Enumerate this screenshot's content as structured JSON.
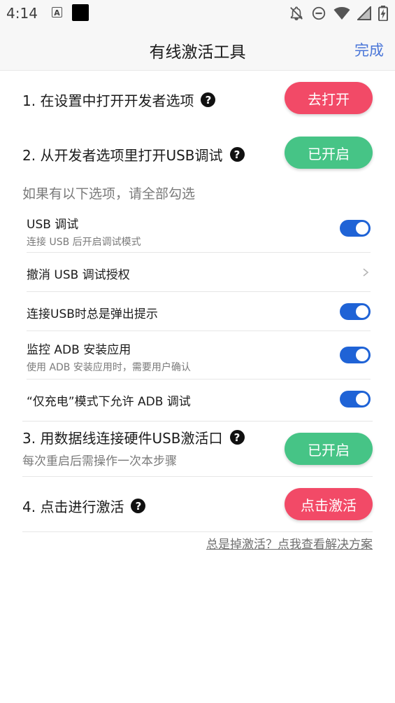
{
  "status_bar": {
    "time": "4:14",
    "icons": [
      "a-badge-icon",
      "black-square-icon",
      "notifications-off-icon",
      "do-not-disturb-icon",
      "wifi-icon",
      "signal-icon",
      "battery-charging-icon"
    ],
    "badge_letter": "A"
  },
  "header": {
    "title": "有线激活工具",
    "done_label": "完成",
    "done_color": "#4a76d8"
  },
  "steps": [
    {
      "label": "1. 在设置中打开开发者选项",
      "button": "去打开",
      "button_color": "#f24a67"
    },
    {
      "label": "2. 从开发者选项里打开USB调试",
      "button": "已开启",
      "button_color": "#46c486"
    },
    {
      "label": "3. 用数据线连接硬件USB激活口",
      "sub": "每次重启后需操作一次本步骤",
      "button": "已开启",
      "button_color": "#46c486"
    },
    {
      "label": "4. 点击进行激活",
      "button": "点击激活",
      "button_color": "#f24a67"
    }
  ],
  "options_hint": "如果有以下选项，请全部勾选",
  "options": [
    {
      "title": "USB 调试",
      "subtitle": "连接 USB 后开启调试模式",
      "control": "toggle",
      "on": true
    },
    {
      "title": "撤消 USB 调试授权",
      "control": "chevron"
    },
    {
      "title": "连接USB时总是弹出提示",
      "control": "toggle",
      "on": true
    },
    {
      "title": "监控 ADB 安装应用",
      "subtitle": "使用 ADB 安装应用时，需要用户确认",
      "control": "toggle",
      "on": true
    },
    {
      "title": "“仅充电”模式下允许 ADB 调试",
      "control": "toggle",
      "on": true
    }
  ],
  "toggle_color": "#1f63d6",
  "help_glyph": "?",
  "footer_link": "总是掉激活？点我查看解决方案"
}
